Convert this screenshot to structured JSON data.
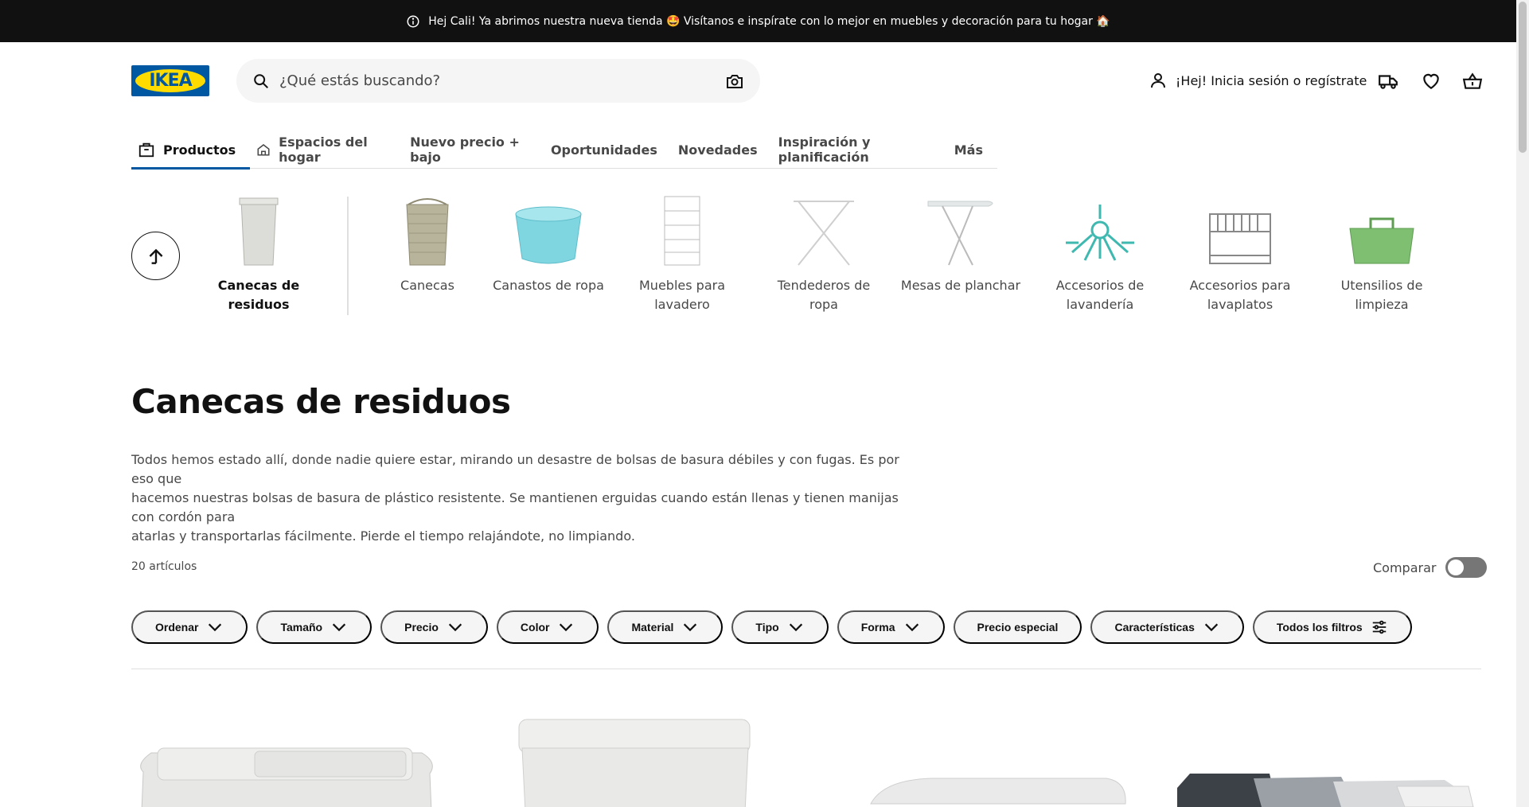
{
  "announcement": {
    "text": "Hej Cali! Ya abrimos nuestra nueva tienda 🤩 Visítanos e inspírate con lo mejor en muebles y decoración para tu hogar 🏠",
    "icon": "info-icon"
  },
  "header": {
    "logo_text": "IKEA",
    "search_placeholder": "¿Qué estás buscando?",
    "account_label": "¡Hej! Inicia sesión o regístrate",
    "icons": [
      "search-icon",
      "camera-icon",
      "user-icon",
      "truck-icon",
      "heart-icon",
      "basket-icon"
    ]
  },
  "nav": {
    "items": [
      {
        "label": "Productos",
        "icon": "bag-icon",
        "active": true
      },
      {
        "label": "Espacios del hogar",
        "icon": "home-icon"
      },
      {
        "label": "Nuevo precio + bajo"
      },
      {
        "label": "Oportunidades"
      },
      {
        "label": "Novedades"
      },
      {
        "label": "Inspiración y planificación"
      },
      {
        "label": "Más"
      }
    ]
  },
  "categories": {
    "current": "Canecas de residuos",
    "items": [
      {
        "line1": "Canecas",
        "line2": ""
      },
      {
        "line1": "Canastos de ropa",
        "line2": ""
      },
      {
        "line1": "Muebles para",
        "line2": "lavadero"
      },
      {
        "line1": "Tendederos de",
        "line2": "ropa"
      },
      {
        "line1": "Mesas de planchar",
        "line2": ""
      },
      {
        "line1": "Accesorios de",
        "line2": "lavandería"
      },
      {
        "line1": "Accesorios para",
        "line2": "lavaplatos"
      },
      {
        "line1": "Utensilios de",
        "line2": "limpieza"
      }
    ]
  },
  "page": {
    "title": "Canecas de residuos",
    "description_lines": [
      "Todos hemos estado allí, donde nadie quiere estar, mirando un desastre de bolsas de basura débiles y con fugas. Es por eso que",
      "hacemos nuestras bolsas de basura de plástico resistente. Se mantienen erguidas cuando están llenas y tienen manijas con cordón para",
      "atarlas y transportarlas fácilmente. Pierde el tiempo relajándote, no limpiando."
    ],
    "count": "20 artículos",
    "compare_label": "Comparar",
    "compare_on": false
  },
  "filters": [
    {
      "label": "Ordenar",
      "icon": "chevron-down-icon"
    },
    {
      "label": "Tamaño",
      "icon": "chevron-down-icon"
    },
    {
      "label": "Precio",
      "icon": "chevron-down-icon"
    },
    {
      "label": "Color",
      "icon": "chevron-down-icon"
    },
    {
      "label": "Material",
      "icon": "chevron-down-icon"
    },
    {
      "label": "Tipo",
      "icon": "chevron-down-icon"
    },
    {
      "label": "Forma",
      "icon": "chevron-down-icon"
    },
    {
      "label": "Precio especial",
      "icon": ""
    },
    {
      "label": "Características",
      "icon": "chevron-down-icon"
    },
    {
      "label": "Todos los filtros",
      "icon": "filter-icon"
    }
  ],
  "colors": {
    "ikea_blue": "#0058a3",
    "ikea_yellow": "#ffdb00",
    "topbar_bg": "#111111"
  }
}
